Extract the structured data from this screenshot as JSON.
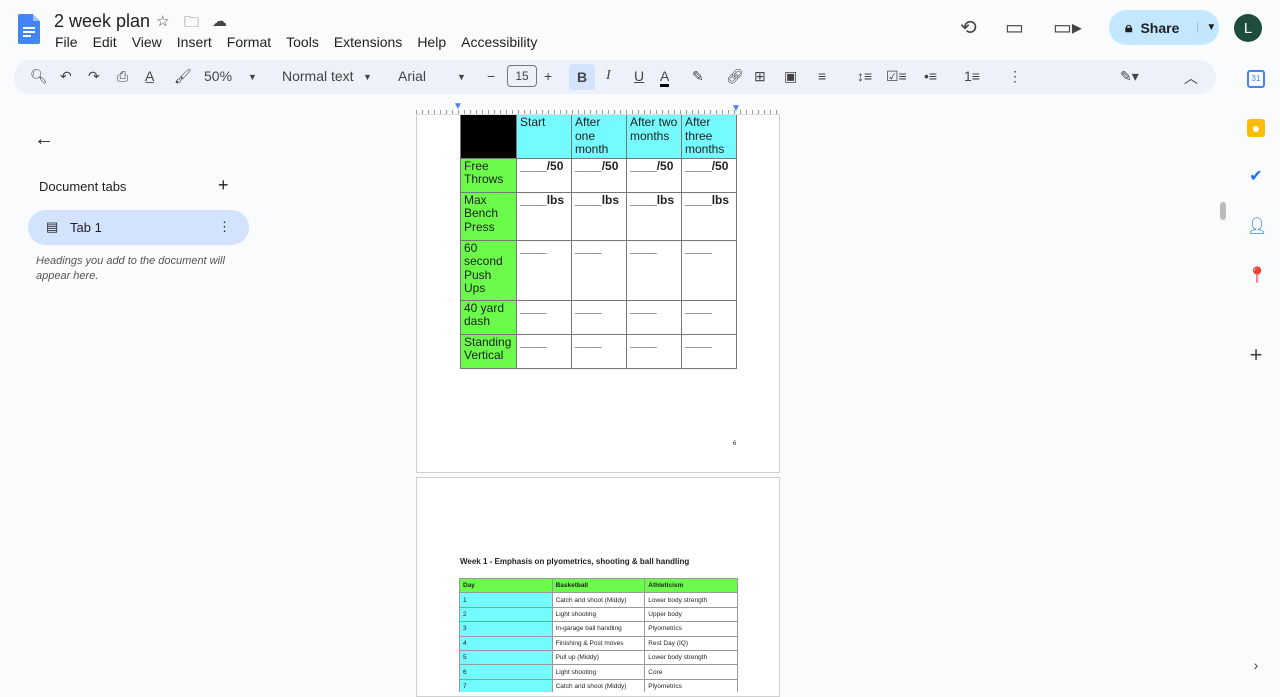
{
  "doc": {
    "title": "2 week plan"
  },
  "menu": [
    "File",
    "Edit",
    "View",
    "Insert",
    "Format",
    "Tools",
    "Extensions",
    "Help",
    "Accessibility"
  ],
  "header": {
    "share_label": "Share",
    "avatar_letter": "L"
  },
  "toolbar": {
    "zoom": "50%",
    "style": "Normal text",
    "font": "Arial",
    "font_size": "15"
  },
  "sidebar": {
    "title": "Document tabs",
    "tab_label": "Tab 1",
    "hint": "Headings you add to the document will appear here."
  },
  "table1": {
    "headers": [
      "",
      "Start",
      "After one month",
      "After two months",
      "After three months"
    ],
    "rows": [
      {
        "label": "Free Throws",
        "cells": [
          "____/50",
          "____/50",
          "____/50",
          "____/50"
        ]
      },
      {
        "label": "Max Bench Press",
        "cells": [
          "____lbs",
          "____lbs",
          "____lbs",
          "____lbs"
        ]
      },
      {
        "label": "60 second Push Ups",
        "cells": [
          "____",
          "____",
          "____",
          "____"
        ]
      },
      {
        "label": "40 yard dash",
        "cells": [
          "____",
          "____",
          "____",
          "____"
        ]
      },
      {
        "label": "Standing Vertical",
        "cells": [
          "____",
          "____",
          "____",
          "____"
        ]
      }
    ],
    "colors": {
      "header": "#74fbff",
      "label": "#6bfb4a",
      "corner": "#000000"
    }
  },
  "page_number": "6",
  "week1": {
    "heading": "Week 1 - Emphasis on plyometrics, shooting & ball handling",
    "headers": [
      "Day",
      "Basketball",
      "Athleticism"
    ],
    "rows": [
      [
        "1",
        "Catch and shoot (Middy)",
        "Lower body strength"
      ],
      [
        "2",
        "Light shooting",
        "Upper body"
      ],
      [
        "3",
        "In-garage ball handling",
        "Plyometrics"
      ],
      [
        "4",
        "Finishing & Post moves",
        "Rest Day (IQ)"
      ],
      [
        "5",
        "Pull up (Middy)",
        "Lower body strength"
      ],
      [
        "6",
        "Light shooting",
        "Core"
      ],
      [
        "7",
        "Catch and shoot (Middy)",
        "Plyometrics"
      ]
    ]
  }
}
